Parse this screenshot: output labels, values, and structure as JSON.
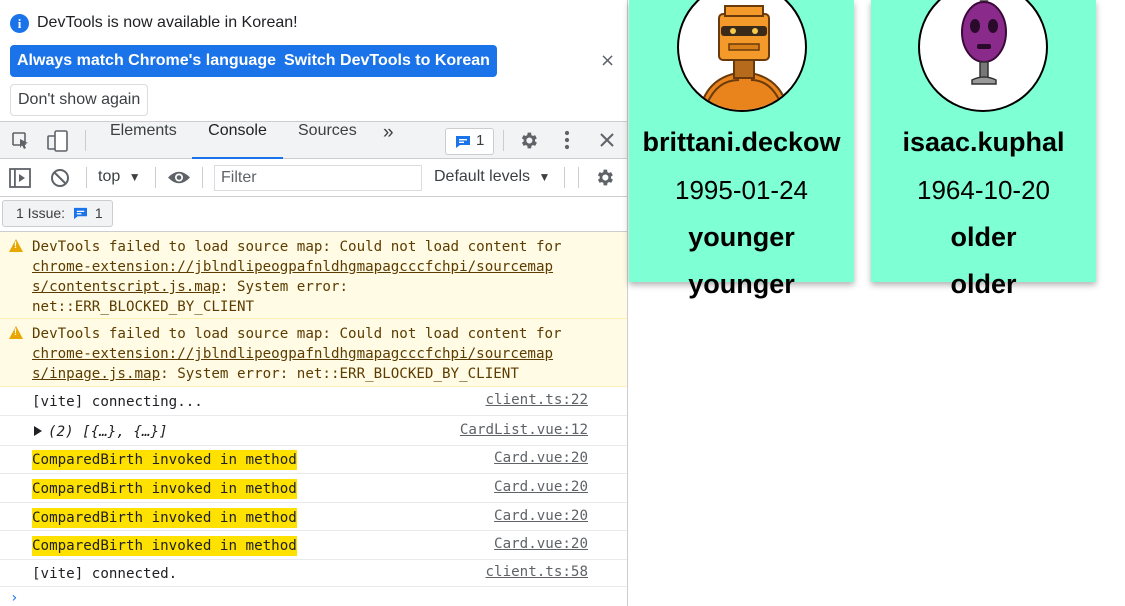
{
  "infobar": {
    "message": "DevTools is now available in Korean!",
    "btn_match": "Always match Chrome's language",
    "btn_switch": "Switch DevTools to Korean",
    "btn_dont_show": "Don't show again",
    "close": "×"
  },
  "tabs": {
    "elements": "Elements",
    "console": "Console",
    "sources": "Sources",
    "more": "»",
    "issue_count": "1"
  },
  "console_toolbar": {
    "context": "top",
    "filter_placeholder": "Filter",
    "levels": "Default levels"
  },
  "issues": {
    "label": "1 Issue:",
    "count": "1"
  },
  "logs": [
    {
      "type": "warning",
      "text_prefix": "DevTools failed to load source map: Could not load content for",
      "link_line1": "chrome-extension://jblndlipeogpafnldhgmapagcccfchpi/sourcemap",
      "link_line2": "s/contentscript.js.map",
      "suffix_line2": ": System error:",
      "line3": "net::ERR_BLOCKED_BY_CLIENT"
    },
    {
      "type": "warning",
      "text_prefix": "DevTools failed to load source map: Could not load content for",
      "link_line1": "chrome-extension://jblndlipeogpafnldhgmapagcccfchpi/sourcemap",
      "link_line2": "s/inpage.js.map",
      "suffix_line2": ": System error: net::ERR_BLOCKED_BY_CLIENT"
    },
    {
      "type": "log",
      "text": "[vite] connecting...",
      "source": "client.ts:22"
    },
    {
      "type": "object",
      "text": "(2) [{…}, {…}]",
      "source": "CardList.vue:12"
    },
    {
      "type": "log",
      "text": "ComparedBirth invoked in method",
      "source": "Card.vue:20",
      "highlighted": true
    },
    {
      "type": "log",
      "text": "ComparedBirth invoked in method",
      "source": "Card.vue:20",
      "highlighted": true
    },
    {
      "type": "log",
      "text": "ComparedBirth invoked in method",
      "source": "Card.vue:20",
      "highlighted": true
    },
    {
      "type": "log",
      "text": "ComparedBirth invoked in method",
      "source": "Card.vue:20",
      "highlighted": true
    },
    {
      "type": "log",
      "text": "[vite] connected.",
      "source": "client.ts:58"
    }
  ],
  "prompt": "›",
  "cards": [
    {
      "name": "brittani.deckow",
      "birthdate": "1995-01-24",
      "relation_1": "younger",
      "relation_2": "younger",
      "avatar_icon": "orange-robot-icon"
    },
    {
      "name": "isaac.kuphal",
      "birthdate": "1964-10-20",
      "relation_1": "older",
      "relation_2": "older",
      "avatar_icon": "purple-robot-icon"
    }
  ],
  "colors": {
    "accent_blue": "#1a73e8",
    "card_bg": "#7fffd4",
    "highlight": "#ffe100",
    "warning_bg": "#fffbe5"
  }
}
